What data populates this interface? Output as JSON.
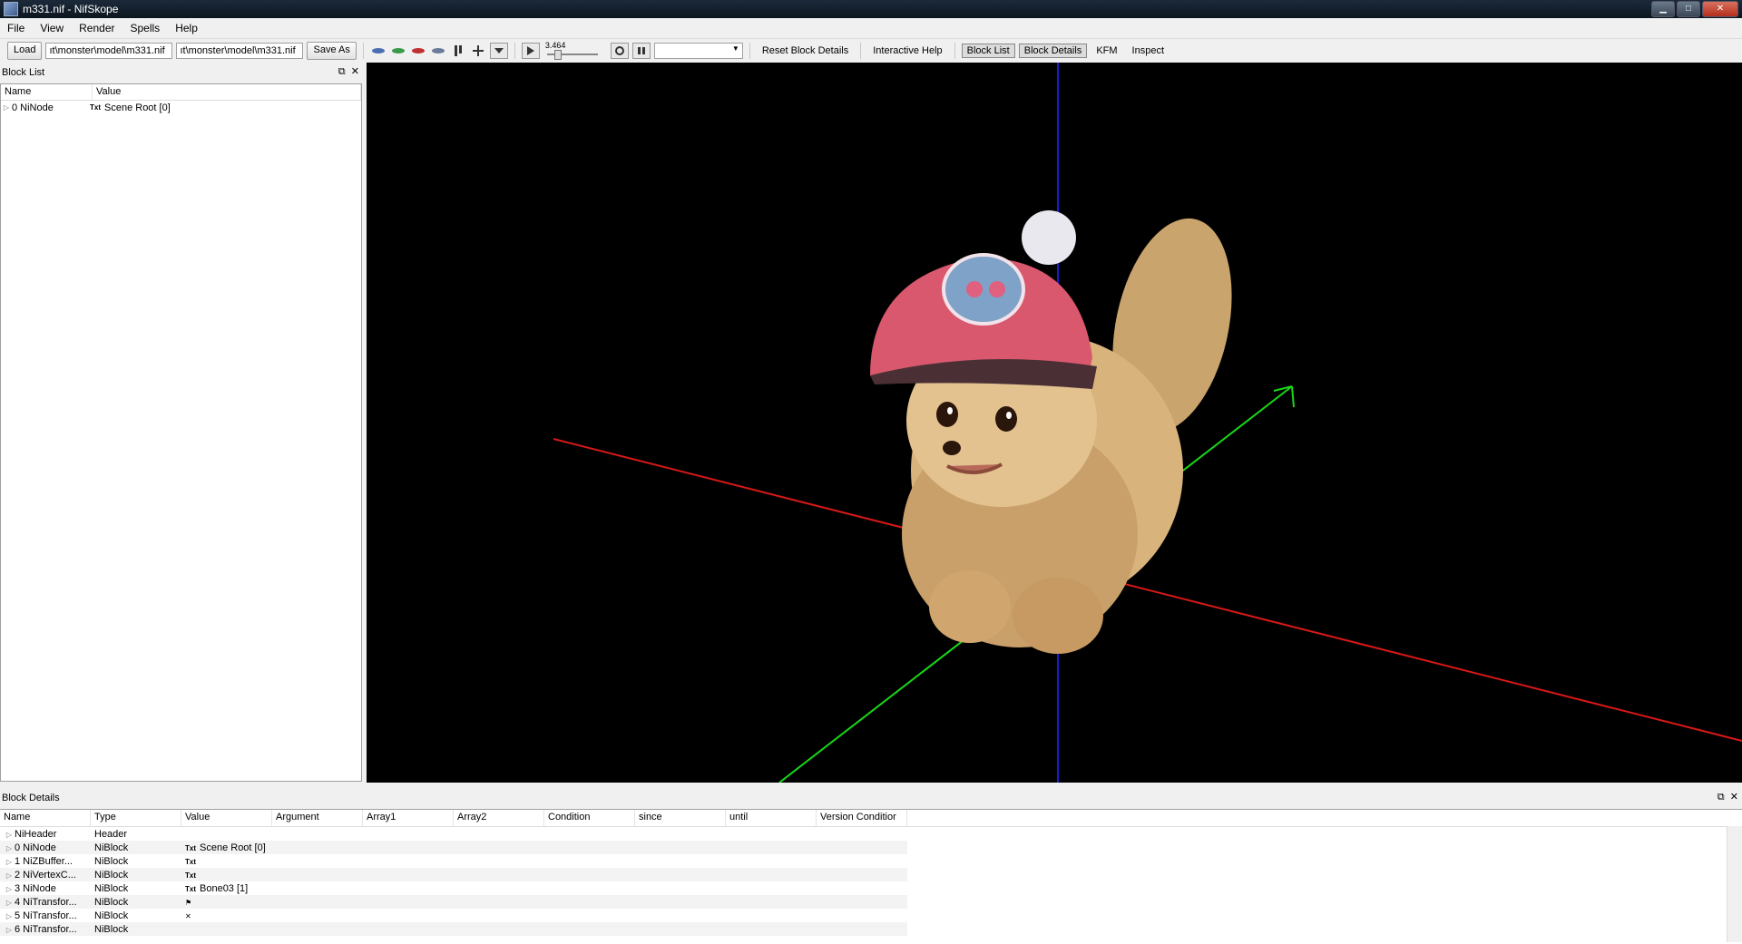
{
  "window": {
    "title": "m331.nif - NifSkope",
    "minimize": "▁",
    "maximize": "□",
    "close": "✕"
  },
  "menu": [
    "File",
    "View",
    "Render",
    "Spells",
    "Help"
  ],
  "toolbar": {
    "load_label": "Load",
    "load_path": "ıt\\monster\\model\\m331.nif",
    "save_path": "ıt\\monster\\model\\m331.nif",
    "save_as_label": "Save As",
    "slider_value": "3.464",
    "links": [
      "Reset Block Details",
      "Interactive Help",
      "Block List",
      "Block Details",
      "KFM",
      "Inspect"
    ],
    "icons": [
      "view-top-icon",
      "view-front-icon",
      "view-side-icon",
      "view-user-icon",
      "lighting-icon",
      "move-icon",
      "view-menu-icon",
      "play-icon",
      "loop-icon",
      "switch-icon"
    ]
  },
  "block_list": {
    "title": "Block List",
    "columns": [
      "Name",
      "Value"
    ],
    "rows": [
      {
        "name": "0 NiNode",
        "value": "Scene Root [0]"
      }
    ]
  },
  "block_details": {
    "title": "Block Details",
    "columns": [
      "Name",
      "Type",
      "Value",
      "Argument",
      "Array1",
      "Array2",
      "Condition",
      "since",
      "until",
      "Version Conditior"
    ],
    "rows": [
      {
        "name": "NiHeader",
        "type": "Header",
        "value": "",
        "badge": ""
      },
      {
        "name": "0 NiNode",
        "type": "NiBlock",
        "value": "Scene Root [0]",
        "badge": "Txt"
      },
      {
        "name": "1 NiZBuffer...",
        "type": "NiBlock",
        "value": "",
        "badge": "Txt"
      },
      {
        "name": "2 NiVertexC...",
        "type": "NiBlock",
        "value": "",
        "badge": "Txt"
      },
      {
        "name": "3 NiNode",
        "type": "NiBlock",
        "value": "Bone03 [1]",
        "badge": "Txt"
      },
      {
        "name": "4 NiTransfor...",
        "type": "NiBlock",
        "value": "",
        "badge": "⚑"
      },
      {
        "name": "5 NiTransfor...",
        "type": "NiBlock",
        "value": "",
        "badge": "✕"
      },
      {
        "name": "6 NiTransfor...",
        "type": "NiBlock",
        "value": "",
        "badge": ""
      }
    ]
  },
  "badge_txt": "Txt",
  "colors": {
    "x_axis": "#e01010",
    "y_axis": "#10e010",
    "z_axis": "#1010e0",
    "viewport_bg": "#000000"
  }
}
